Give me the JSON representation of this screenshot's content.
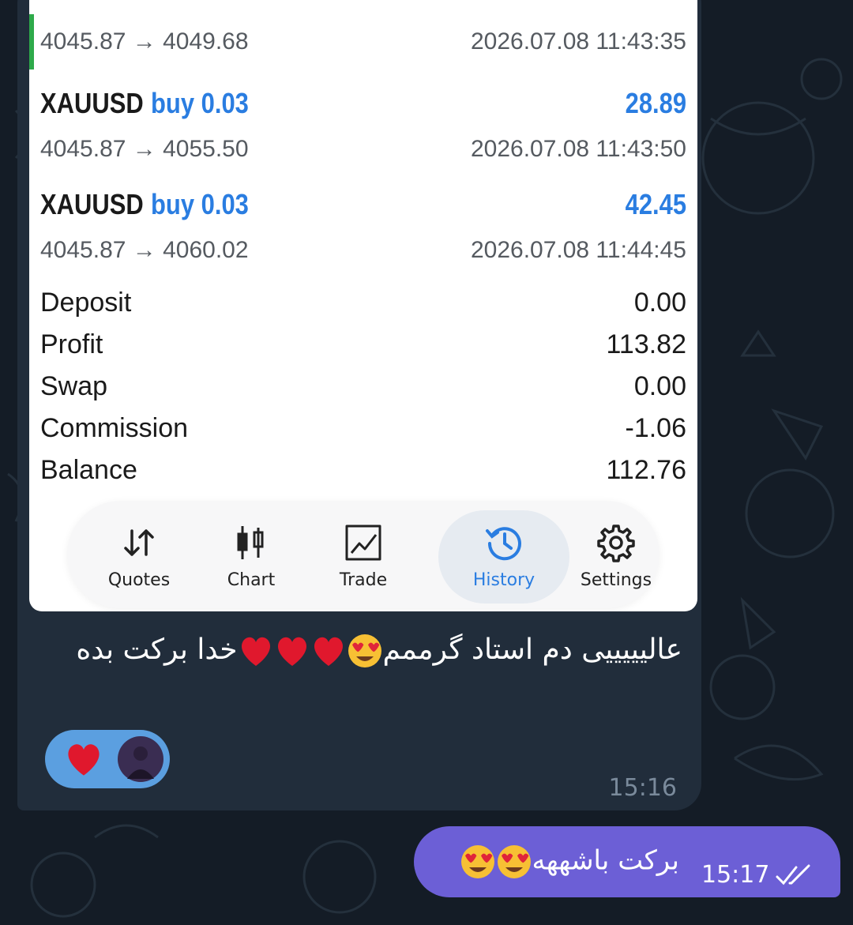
{
  "partial_trade": {
    "prices": "4045.87 → 4049.68",
    "time": "2026.07.08 11:43:35"
  },
  "trades": [
    {
      "symbol": "XAUUSD",
      "side": "buy 0.03",
      "profit": "28.89",
      "prices": "4045.87 → 4055.50",
      "time": "2026.07.08 11:43:50"
    },
    {
      "symbol": "XAUUSD",
      "side": "buy 0.03",
      "profit": "42.45",
      "prices": "4045.87 → 4060.02",
      "time": "2026.07.08 11:44:45"
    }
  ],
  "summary": [
    {
      "label": "Deposit",
      "value": "0.00"
    },
    {
      "label": "Profit",
      "value": "113.82"
    },
    {
      "label": "Swap",
      "value": "0.00"
    },
    {
      "label": "Commission",
      "value": "-1.06"
    },
    {
      "label": "Balance",
      "value": "112.76"
    }
  ],
  "tabs": [
    {
      "label": "Quotes",
      "icon": "quotes-arrows-icon"
    },
    {
      "label": "Chart",
      "icon": "candlestick-icon"
    },
    {
      "label": "Trade",
      "icon": "trade-chart-icon"
    },
    {
      "label": "History",
      "icon": "history-clock-icon",
      "active": true
    },
    {
      "label": "Settings",
      "icon": "gear-icon"
    }
  ],
  "incoming_message": {
    "text_part1": "عالیییییی دم استاد گرممم",
    "text_part2": "خدا برکت بده",
    "time": "15:16",
    "reaction": "heart"
  },
  "outgoing_message": {
    "text": "برکت باشههه",
    "time": "15:17",
    "status": "read"
  },
  "colors": {
    "chat_bg": "#141c26",
    "incoming_bubble": "#212d3b",
    "outgoing_bubble": "#6c5fd6",
    "accent_blue": "#2a7de1",
    "reaction_pill": "#5b9fe0"
  }
}
